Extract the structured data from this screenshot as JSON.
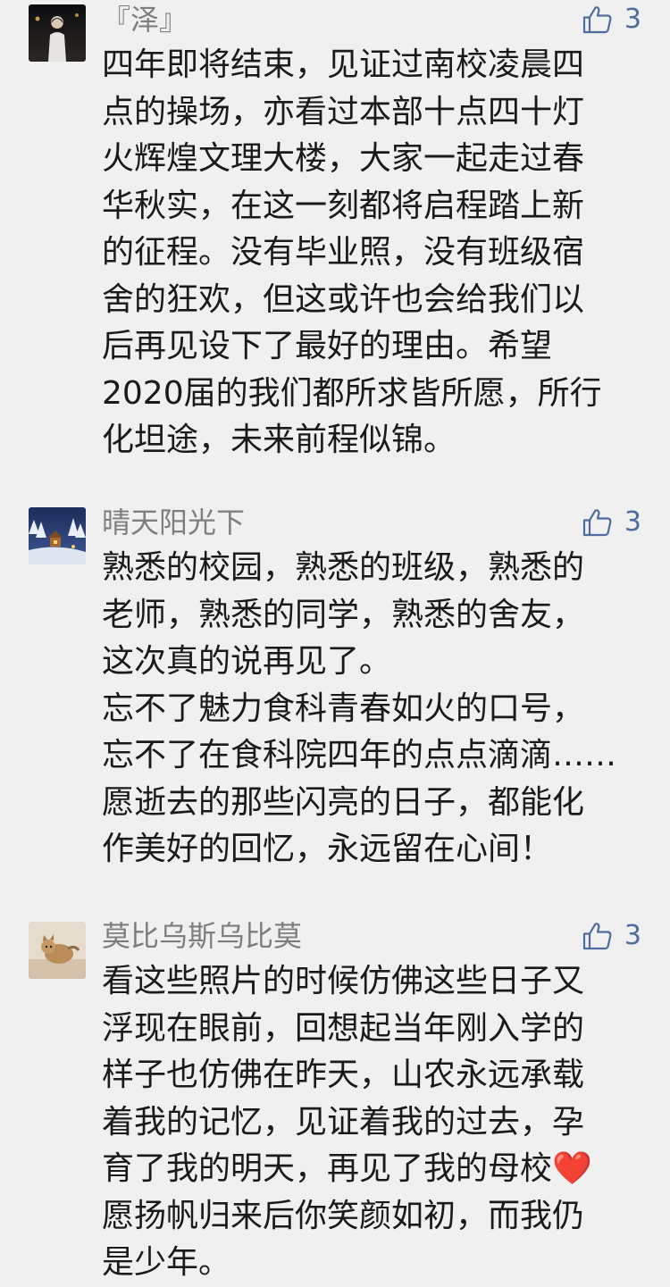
{
  "comments": [
    {
      "nickname": "『泽』",
      "likes": "3",
      "avatar_icon": "person-photo-avatar",
      "lines": [
        "四年即将结束，见证过南校凌晨四",
        "点的操场，亦看过本部十点四十灯",
        "火辉煌文理大楼，大家一起走过春",
        "华秋实，在这一刻都将启程踏上新",
        "的征程。没有毕业照，没有班级宿",
        "舍的狂欢，但这或许也会给我们以",
        "后再见设下了最好的理由。希望",
        "2020届的我们都所求皆所愿，所行",
        "化坦途，未来前程似锦。"
      ]
    },
    {
      "nickname": "晴天阳光下",
      "likes": "3",
      "avatar_icon": "snowy-cabin-avatar",
      "lines": [
        "熟悉的校园，熟悉的班级，熟悉的",
        "老师，熟悉的同学，熟悉的舍友，",
        "这次真的说再见了。",
        "忘不了魅力食科青春如火的口号，",
        "忘不了在食科院四年的点点滴滴……",
        "愿逝去的那些闪亮的日子，都能化",
        "作美好的回忆，永远留在心间！"
      ]
    },
    {
      "nickname": "莫比乌斯乌比莫",
      "likes": "3",
      "avatar_icon": "cat-photo-avatar",
      "lines": [
        "看这些照片的时候仿佛这些日子又",
        "浮现在眼前，回想起当年刚入学的",
        "样子也仿佛在昨天，山农永远承载",
        "着我的记忆，见证着我的过去，孕",
        "育了我的明天，再见了我的母校❤️",
        "愿扬帆归来后你笑颜如初，而我仍",
        "是少年。"
      ]
    }
  ],
  "colors": {
    "background": "#f0f0f0",
    "nickname": "#7e7e7e",
    "like_accent": "#4f6c9f",
    "text": "#1a1a1a"
  },
  "icons": {
    "like": "thumbs-up-icon"
  }
}
